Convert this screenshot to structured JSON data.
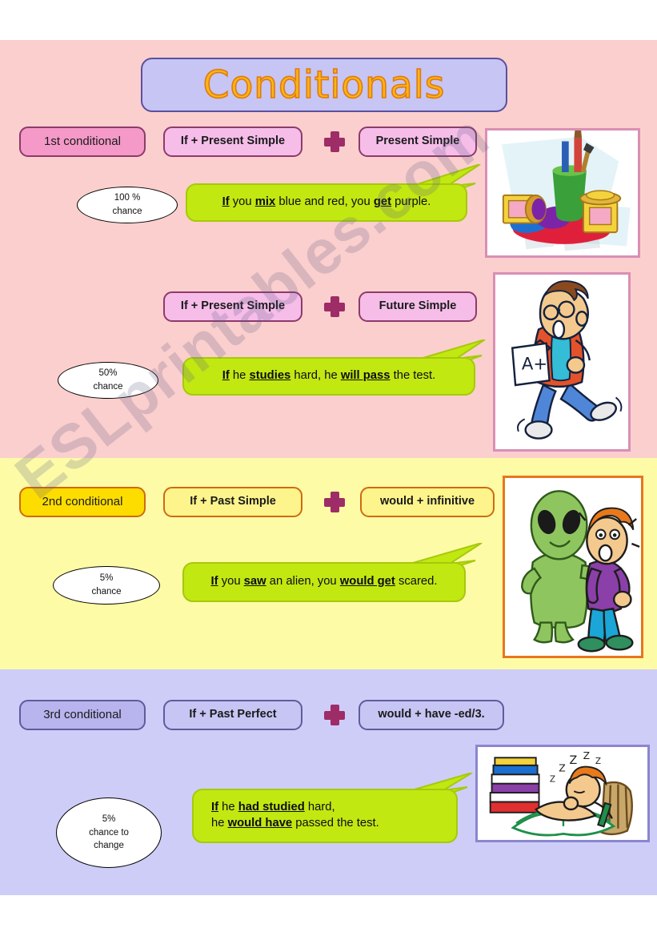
{
  "title": "Conditionals",
  "watermark": "ESLprintables.com",
  "plus_symbol": "+",
  "sections": [
    {
      "id": "first",
      "tag": "1st conditional",
      "rows": [
        {
          "if_clause": "If + Present Simple",
          "result_clause": "Present Simple",
          "chance": [
            "100 %",
            "chance"
          ],
          "example": "If you mix blue and red, you get purple."
        },
        {
          "if_clause": "If + Present Simple",
          "result_clause": "Future Simple",
          "chance": [
            "50%",
            "chance"
          ],
          "example": "If he studies hard, he will pass the test."
        }
      ]
    },
    {
      "id": "second",
      "tag": "2nd conditional",
      "rows": [
        {
          "if_clause": "If + Past Simple",
          "result_clause": "would + infinitive",
          "chance": [
            "5%",
            "chance"
          ],
          "example": "If you saw an alien, you would get scared."
        }
      ]
    },
    {
      "id": "third",
      "tag": "3rd conditional",
      "rows": [
        {
          "if_clause": "If + Past Perfect",
          "result_clause": "would + have -ed/3.",
          "chance": [
            "5%",
            "chance to",
            "change"
          ],
          "example_line1": "If he had studied hard,",
          "example_line2": "he would have passed the test."
        }
      ]
    }
  ],
  "sentences": {
    "s1": {
      "w1": "If",
      "w2": " you ",
      "w3": "mix",
      "w4": " blue and red, you ",
      "w5": "get",
      "w6": " purple."
    },
    "s2": {
      "w1": "If",
      "w2": " he ",
      "w3": "studies",
      "w4": " hard, he ",
      "w5": "will pass",
      "w6": " the test."
    },
    "s3": {
      "w1": "If",
      "w2": " you ",
      "w3": "saw",
      "w4": " an alien, you ",
      "w5": "would get",
      "w6": " scared."
    },
    "s4": {
      "w1": "If",
      "w2": " he ",
      "w3": "had studied",
      "w4": " hard,",
      "w5": "he ",
      "w6": "would have",
      "w7": " passed the test."
    }
  },
  "images": [
    {
      "name": "paint-supplies-illustration",
      "alt": "Paint jars, brushes in a green cup and spilled blue and red paint mixing into purple"
    },
    {
      "name": "happy-student-with-a-plus-illustration",
      "alt": "Boy running happily holding a test paper marked A+"
    },
    {
      "name": "alien-and-scared-boy-illustration",
      "alt": "Green alien touching a frightened boy in a purple shirt"
    },
    {
      "name": "sleeping-student-on-book-illustration",
      "alt": "Boy asleep on an open book beside a stack of books"
    }
  ],
  "colors": {
    "band_pink": "#fbcfcd",
    "band_yellow": "#fdfba6",
    "band_purple": "#cecdf8",
    "bubble_green": "#c2e812",
    "title_orange": "#fbb515",
    "accent_magenta": "#9e2c67"
  }
}
